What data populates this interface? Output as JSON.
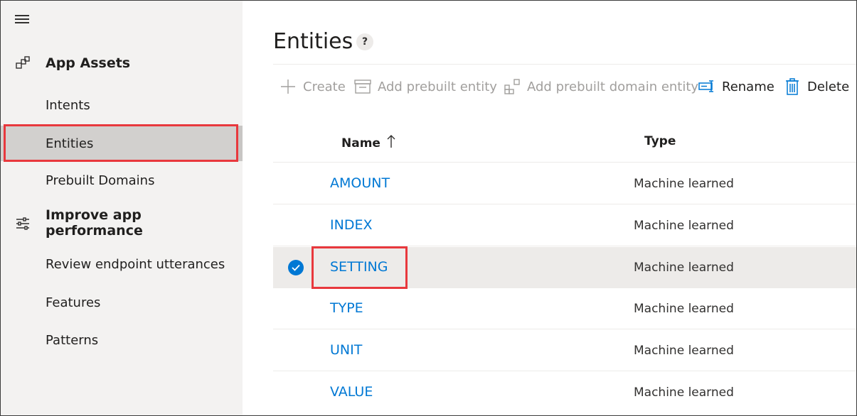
{
  "sidebar": {
    "groups": [
      {
        "icon": "app-assets-icon",
        "label": "App Assets"
      },
      {
        "icon": "sliders-icon",
        "label": "Improve app performance"
      }
    ],
    "items": [
      {
        "label": "Intents"
      },
      {
        "label": "Entities",
        "selected": true
      },
      {
        "label": "Prebuilt Domains"
      },
      {
        "label": "Review endpoint utterances"
      },
      {
        "label": "Features"
      },
      {
        "label": "Patterns"
      }
    ]
  },
  "page": {
    "title": "Entities",
    "help": "?"
  },
  "toolbar": {
    "create": "Create",
    "add_prebuilt": "Add prebuilt entity",
    "add_prebuilt_domain": "Add prebuilt domain entity",
    "rename": "Rename",
    "delete": "Delete"
  },
  "table": {
    "columns": {
      "name": "Name",
      "type": "Type"
    },
    "rows": [
      {
        "name": "AMOUNT",
        "type": "Machine learned",
        "selected": false
      },
      {
        "name": "INDEX",
        "type": "Machine learned",
        "selected": false
      },
      {
        "name": "SETTING",
        "type": "Machine learned",
        "selected": true
      },
      {
        "name": "TYPE",
        "type": "Machine learned",
        "selected": false
      },
      {
        "name": "UNIT",
        "type": "Machine learned",
        "selected": false
      },
      {
        "name": "VALUE",
        "type": "Machine learned",
        "selected": false
      }
    ]
  },
  "colors": {
    "accent": "#0078d4",
    "highlight": "#e8383d",
    "sidebar_bg": "#f3f2f1",
    "selected_bg": "#d2d0ce"
  }
}
